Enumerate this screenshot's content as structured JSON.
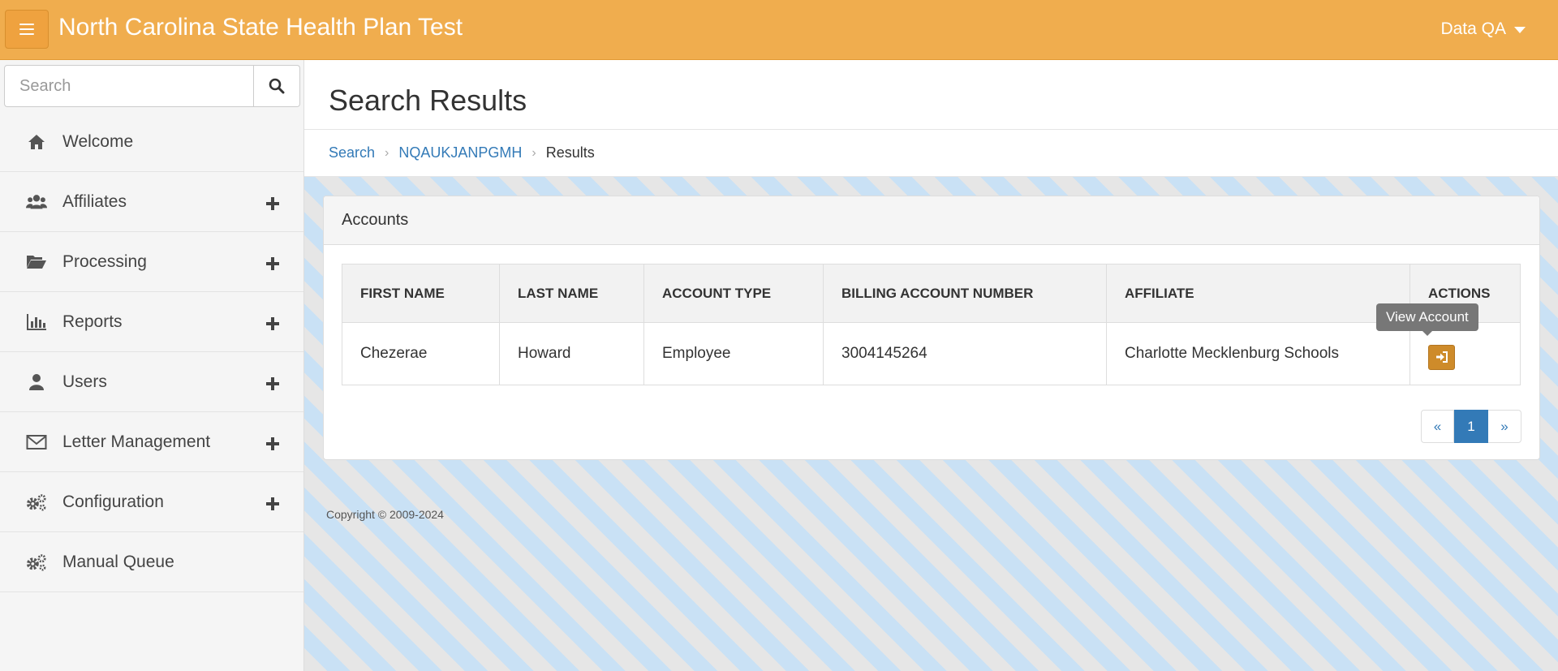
{
  "header": {
    "title": "North Carolina State Health Plan Test",
    "user_label": "Data QA"
  },
  "sidebar": {
    "search_placeholder": "Search",
    "items": [
      {
        "label": "Welcome",
        "icon": "home-icon",
        "expandable": false
      },
      {
        "label": "Affiliates",
        "icon": "users-icon",
        "expandable": true
      },
      {
        "label": "Processing",
        "icon": "folder-open-icon",
        "expandable": true
      },
      {
        "label": "Reports",
        "icon": "bar-chart-icon",
        "expandable": true
      },
      {
        "label": "Users",
        "icon": "user-icon",
        "expandable": true
      },
      {
        "label": "Letter Management",
        "icon": "envelope-icon",
        "expandable": true
      },
      {
        "label": "Configuration",
        "icon": "gears-icon",
        "expandable": true
      },
      {
        "label": "Manual Queue",
        "icon": "gears-icon",
        "expandable": false
      }
    ]
  },
  "page": {
    "title": "Search Results",
    "breadcrumb": [
      "Search",
      "NQAUKJANPGMH",
      "Results"
    ]
  },
  "accounts": {
    "heading": "Accounts",
    "columns": [
      "FIRST NAME",
      "LAST NAME",
      "ACCOUNT TYPE",
      "BILLING ACCOUNT NUMBER",
      "AFFILIATE",
      "ACTIONS"
    ],
    "rows": [
      {
        "first_name": "Chezerae",
        "last_name": "Howard",
        "account_type": "Employee",
        "billing_account_number": "3004145264",
        "affiliate": "Charlotte Mecklenburg Schools"
      }
    ],
    "action_tooltip": "View Account"
  },
  "pagination": {
    "prev": "«",
    "current": "1",
    "next": "»"
  },
  "footer": {
    "copyright": "Copyright © 2009-2024"
  },
  "colors": {
    "topbar": "#F0AD4E",
    "link": "#337ab7",
    "action_button": "#ce8b2a"
  }
}
